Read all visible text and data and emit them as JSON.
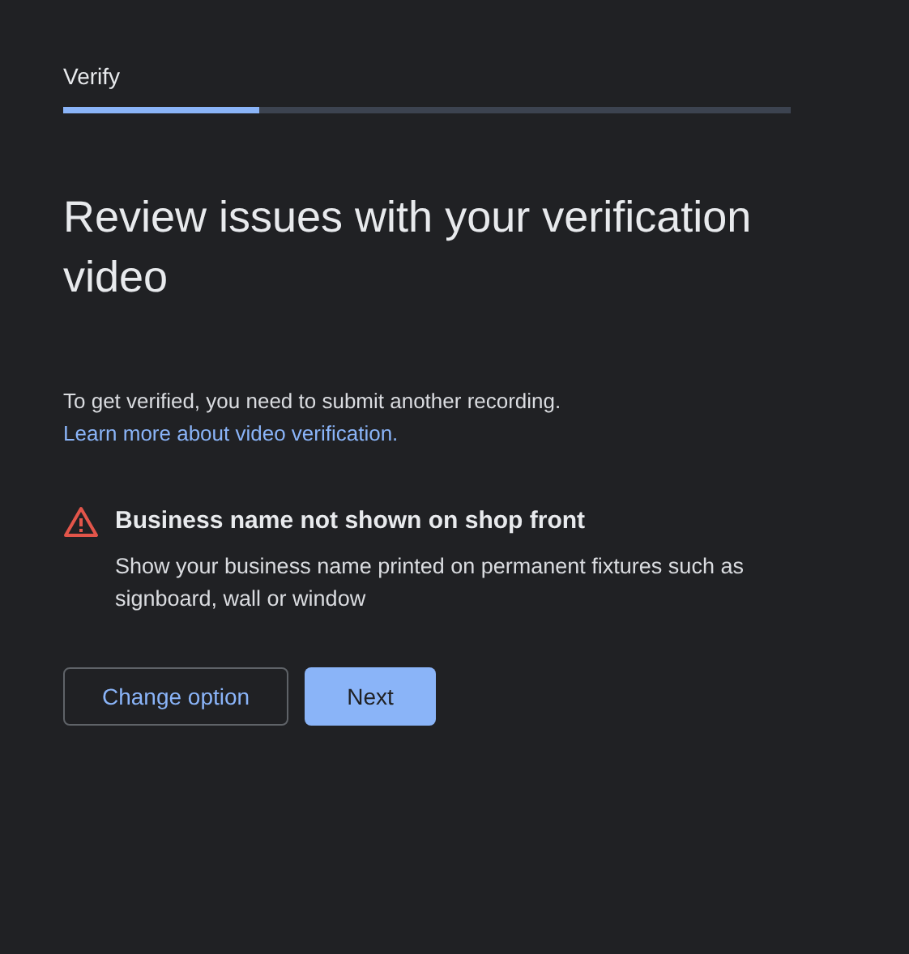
{
  "step": {
    "label": "Verify",
    "level": 0.27
  },
  "title": "Review issues with your verification video",
  "intro": {
    "text": "To get verified, you need to submit another recording.",
    "link": "Learn more about video verification."
  },
  "issues": [
    {
      "kind": "warning",
      "title": "Business name not shown on shop front",
      "description": "Show your business name printed on permanent fixtures such as signboard, wall or window"
    }
  ],
  "buttons": [
    {
      "kind": "outlined",
      "label": "Change option"
    },
    {
      "kind": "filled",
      "label": "Next"
    }
  ]
}
